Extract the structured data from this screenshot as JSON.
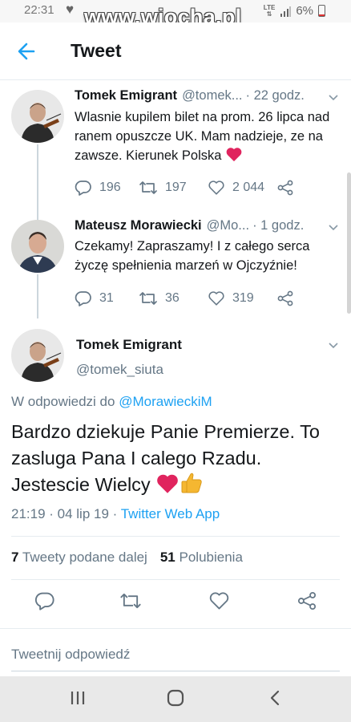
{
  "status_bar": {
    "time": "22:31",
    "network": "LTE",
    "battery": "6%"
  },
  "watermark": "www.wiocha.pl",
  "header": {
    "title": "Tweet"
  },
  "tweets": [
    {
      "name": "Tomek Emigrant",
      "handle": "@tomek...",
      "time": "· 22 godz.",
      "text": "Wlasnie kupilem bilet na prom. 26 lipca nad ranem opuszcze UK. Mam nadzieje, ze na zawsze. Kierunek Polska",
      "replies": "196",
      "retweets": "197",
      "likes": "2 044"
    },
    {
      "name": "Mateusz Morawiecki",
      "handle": "@Mo...",
      "time": "· 1 godz.",
      "text": "Czekamy! Zapraszamy! I z całego serca życzę spełnienia marzeń w Ojczyźnie!",
      "replies": "31",
      "retweets": "36",
      "likes": "319"
    }
  ],
  "main_tweet": {
    "name": "Tomek Emigrant",
    "handle": "@tomek_siuta",
    "reply_prefix": "W odpowiedzi do",
    "reply_to": "@MorawieckiM",
    "text": "Bardzo dziekuje Panie Premierze. To zasluga Pana I calego Rzadu. Jestescie Wielcy",
    "timestamp": "21:19 · 04 lip 19 ·",
    "client": "Twitter Web App",
    "retweets_count": "7",
    "retweets_label": "Tweety podane dalej",
    "likes_count": "51",
    "likes_label": "Polubienia"
  },
  "reply_box": {
    "placeholder": "Tweetnij odpowiedź"
  },
  "colors": {
    "accent": "#1da1f2",
    "heart": "#e0245e",
    "secondary_text": "#657786"
  }
}
